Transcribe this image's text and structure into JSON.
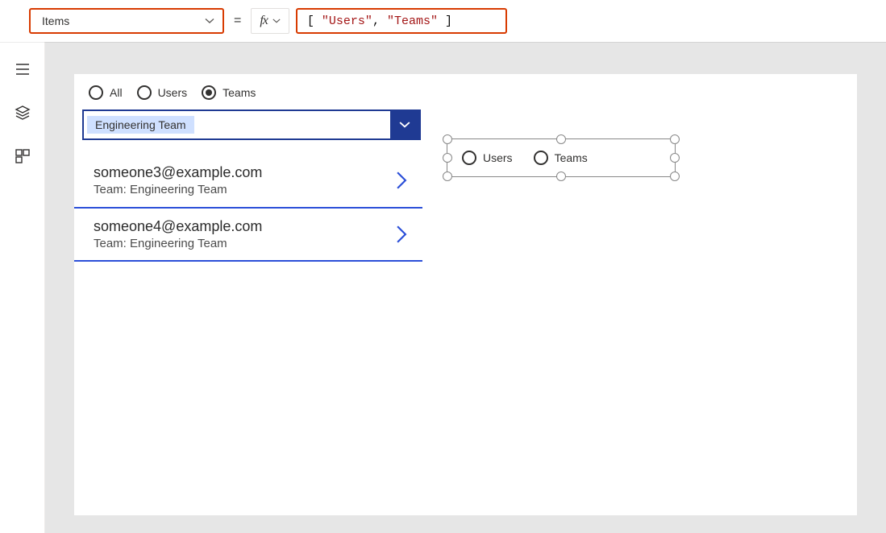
{
  "formula_bar": {
    "property": "Items",
    "equals": "=",
    "fx_label": "fx",
    "tokens": {
      "lb": "[",
      "s1": "\"Users\"",
      "comma": ",",
      "s2": "\"Teams\"",
      "rb": "]"
    }
  },
  "canvas": {
    "radios": {
      "all": "All",
      "users": "Users",
      "teams": "Teams"
    },
    "dropdown_value": "Engineering Team",
    "list": [
      {
        "email": "someone3@example.com",
        "team_line": "Team: Engineering Team"
      },
      {
        "email": "someone4@example.com",
        "team_line": "Team: Engineering Team"
      }
    ],
    "selected_radio": {
      "opt1": "Users",
      "opt2": "Teams"
    }
  }
}
